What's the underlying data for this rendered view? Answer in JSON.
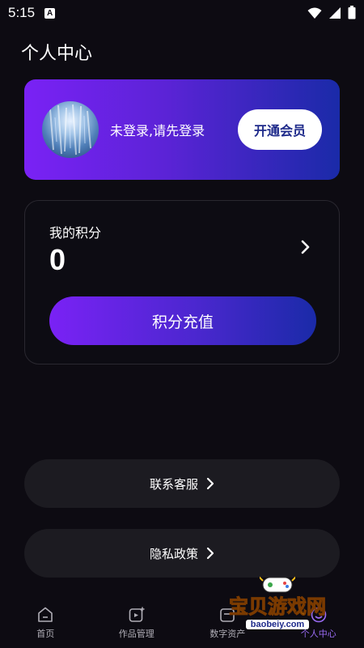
{
  "status_bar": {
    "time": "5:15",
    "notification_icon": "a-icon",
    "icons": [
      "wifi-icon",
      "signal-icon",
      "battery-icon"
    ]
  },
  "page": {
    "title": "个人中心"
  },
  "vip_card": {
    "login_prompt": "未登录,请先登录",
    "vip_button_label": "开通会员"
  },
  "points": {
    "label": "我的积分",
    "value": "0",
    "recharge_label": "积分充值"
  },
  "menu": {
    "contact_label": "联系客服",
    "privacy_label": "隐私政策"
  },
  "bottom_nav": {
    "items": [
      {
        "label": "首页",
        "icon": "home-icon"
      },
      {
        "label": "作品管理",
        "icon": "works-icon"
      },
      {
        "label": "数字资产",
        "icon": "asset-icon"
      },
      {
        "label": "个人中心",
        "icon": "profile-icon"
      }
    ],
    "active_index": 3
  },
  "watermark": {
    "text": "宝贝游戏网",
    "url": "baobeiy.com"
  },
  "colors": {
    "background": "#0d0b12",
    "gradient_start": "#7a22f5",
    "gradient_end": "#1a2aa8",
    "active_nav": "#9b6cf5"
  }
}
